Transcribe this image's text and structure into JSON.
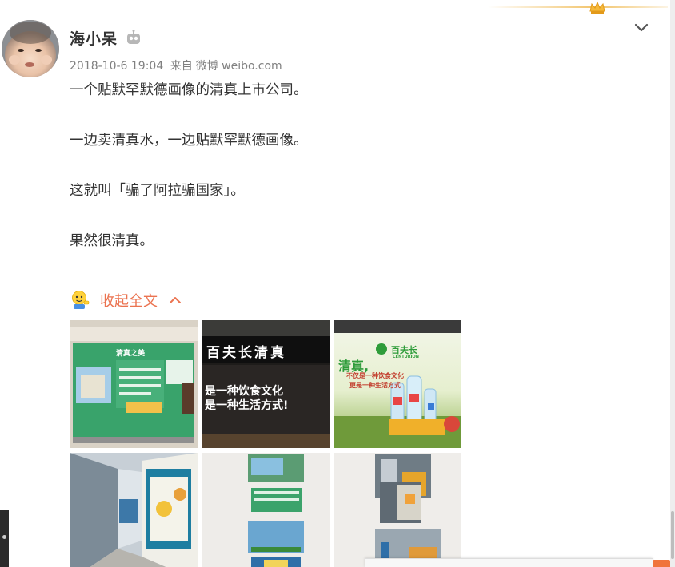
{
  "post": {
    "username": "海小呆",
    "timestamp": "2018-10-6 19:04",
    "source_prefix": "来自",
    "source": "微博 weibo.com",
    "paragraphs": [
      "一个贴默罕默德画像的清真上市公司。",
      "一边卖清真水，一边贴默罕默德画像。",
      "这就叫「骗了阿拉骗国家」。",
      "果然很清真。"
    ],
    "collapse_label": "收起全文"
  },
  "images": [
    {
      "caption": "清真之美"
    },
    {
      "caption_top": "百夫长清真",
      "caption_line1": "是一种饮食文化",
      "caption_line2": "是一种生活方式!"
    },
    {
      "brand": "百夫长",
      "brand_en": "CENTURION",
      "caption_big": "清真,",
      "caption_line1": "不仅是一种饮食文化",
      "caption_line2": "更是一种生活方式"
    },
    {
      "caption": ""
    },
    {
      "caption": ""
    },
    {
      "caption": ""
    }
  ],
  "colors": {
    "accent": "#eb7350",
    "text": "#333333",
    "meta": "#808080",
    "username": "#333333"
  },
  "icons": {
    "crown": "crown-icon",
    "robot": "robot-badge-icon",
    "dropdown": "chevron-down-icon",
    "collapse": "chevron-up-icon",
    "emoji": "emoji-icon"
  }
}
